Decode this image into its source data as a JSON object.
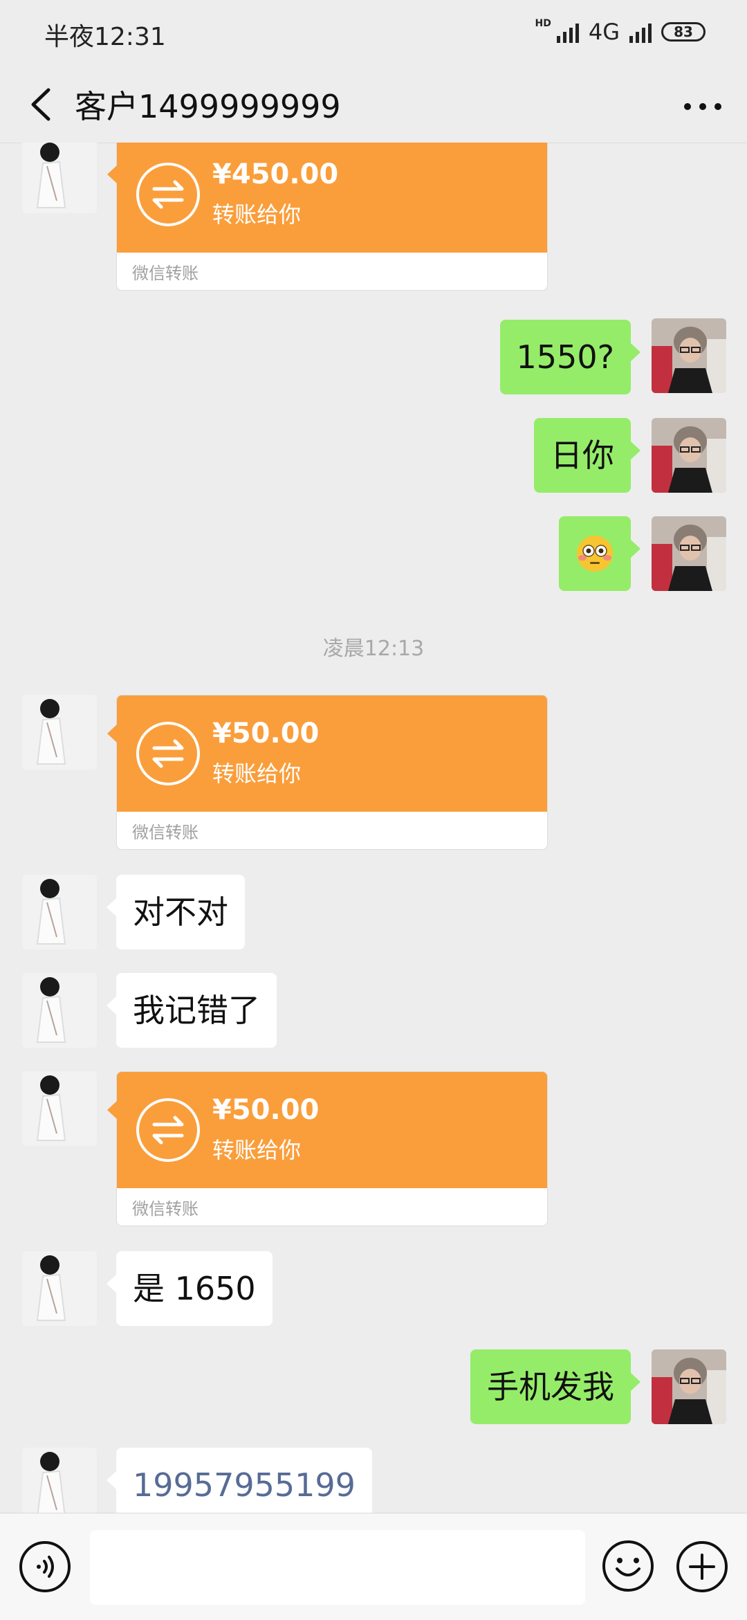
{
  "status": {
    "time": "半夜12:31",
    "hd": "HD",
    "network": "4G",
    "battery": "83"
  },
  "header": {
    "title": "客户1499999999"
  },
  "messages": {
    "m1": {
      "amount": "¥450.00",
      "desc": "转账给你",
      "footer": "微信转账"
    },
    "m2": {
      "text": "1550?"
    },
    "m3": {
      "text": "日你"
    },
    "m4": {
      "emoji": "flushed-face"
    },
    "divider": {
      "text": "凌晨12:13"
    },
    "m5": {
      "amount": "¥50.00",
      "desc": "转账给你",
      "footer": "微信转账"
    },
    "m6": {
      "text": "对不对"
    },
    "m7": {
      "text": "我记错了"
    },
    "m8": {
      "amount": "¥50.00",
      "desc": "转账给你",
      "footer": "微信转账"
    },
    "m9": {
      "text": "是 1650"
    },
    "m10": {
      "text": "手机发我"
    },
    "m11": {
      "text": "19957955199"
    }
  },
  "colors": {
    "transfer": "#fa9e3b",
    "sent_bubble": "#95ec69",
    "link": "#576b95",
    "background": "#ededed"
  },
  "icons": [
    "back-icon",
    "more-icon",
    "transfer-arrows-icon",
    "voice-icon",
    "emoji-icon",
    "plus-icon"
  ]
}
